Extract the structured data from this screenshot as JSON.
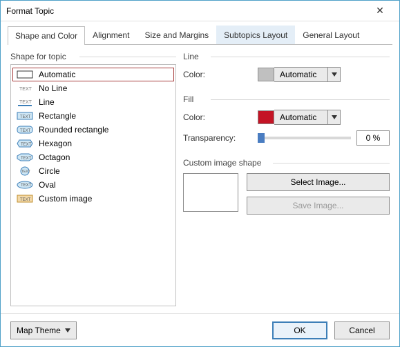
{
  "window": {
    "title": "Format Topic"
  },
  "tabs": [
    {
      "label": "Shape and Color",
      "active": true
    },
    {
      "label": "Alignment"
    },
    {
      "label": "Size and Margins"
    },
    {
      "label": "Subtopics Layout",
      "highlight": true
    },
    {
      "label": "General Layout"
    }
  ],
  "left": {
    "group": "Shape for topic",
    "items": [
      {
        "label": "Automatic",
        "selected": true,
        "icon": "rect-outline"
      },
      {
        "label": "No Line",
        "icon": "text-only"
      },
      {
        "label": "Line",
        "icon": "underline"
      },
      {
        "label": "Rectangle",
        "icon": "rect-blue"
      },
      {
        "label": "Rounded rectangle",
        "icon": "roundrect-blue"
      },
      {
        "label": "Hexagon",
        "icon": "hexagon-blue"
      },
      {
        "label": "Octagon",
        "icon": "octagon-blue"
      },
      {
        "label": "Circle",
        "icon": "circle-blue"
      },
      {
        "label": "Oval",
        "icon": "oval-blue"
      },
      {
        "label": "Custom image",
        "icon": "image"
      }
    ]
  },
  "right": {
    "line": {
      "group": "Line",
      "color_label": "Color:",
      "swatch": "#c0c0c0",
      "value": "Automatic"
    },
    "fill": {
      "group": "Fill",
      "color_label": "Color:",
      "swatch": "#c41425",
      "value": "Automatic",
      "transparency_label": "Transparency:",
      "transparency_value": "0 %"
    },
    "image": {
      "group": "Custom image shape",
      "select_label": "Select Image...",
      "save_label": "Save Image..."
    }
  },
  "footer": {
    "maptheme": "Map Theme",
    "ok": "OK",
    "cancel": "Cancel"
  }
}
